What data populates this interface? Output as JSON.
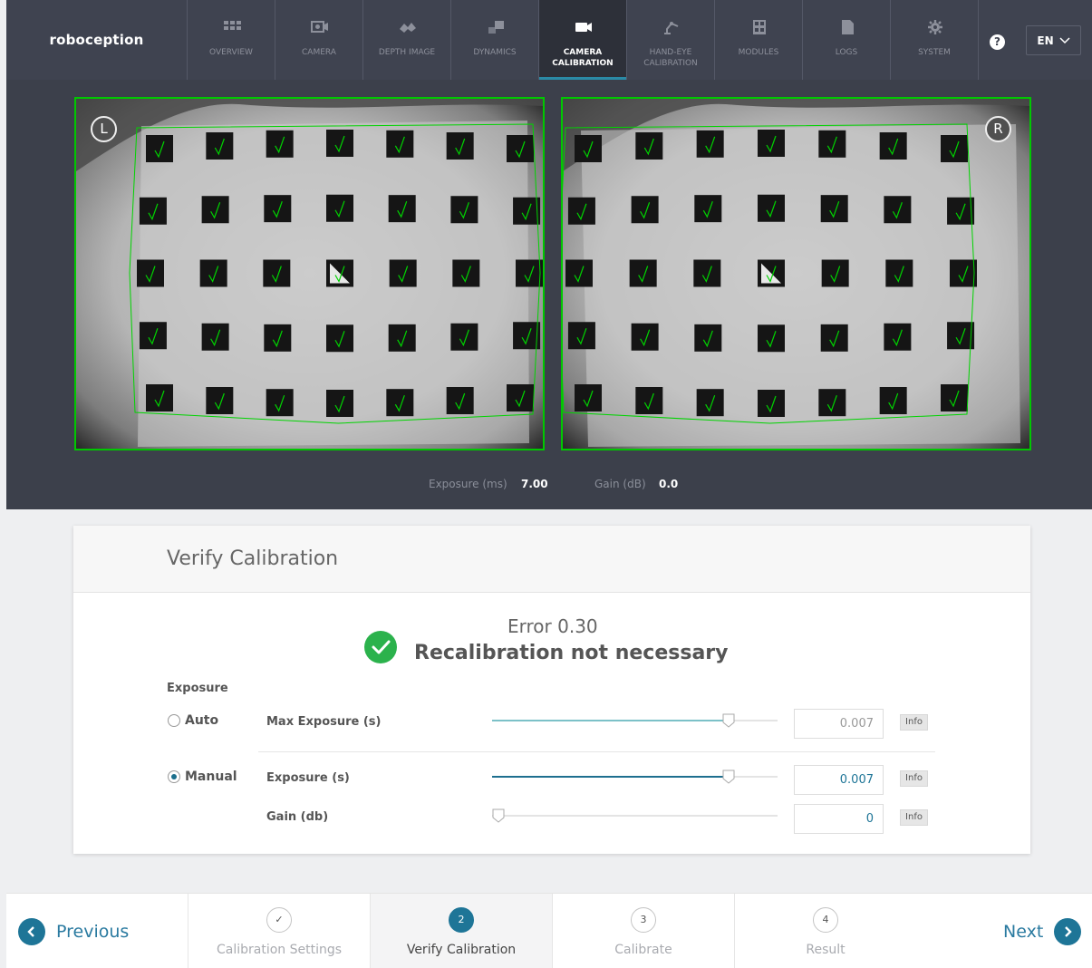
{
  "brand": "roboception",
  "nav": [
    {
      "label": "OVERVIEW",
      "icon": "grid-icon",
      "active": false
    },
    {
      "label": "CAMERA",
      "icon": "camera-icon",
      "active": false
    },
    {
      "label": "DEPTH IMAGE",
      "icon": "depth-image-icon",
      "active": false
    },
    {
      "label": "DYNAMICS",
      "icon": "dynamics-icon",
      "active": false
    },
    {
      "label": "CAMERA\nCALIBRATION",
      "icon": "video-camera-icon",
      "active": true
    },
    {
      "label": "HAND-EYE\nCALIBRATION",
      "icon": "robot-arm-icon",
      "active": false
    },
    {
      "label": "MODULES",
      "icon": "modules-icon",
      "active": false
    },
    {
      "label": "LOGS",
      "icon": "document-icon",
      "active": false
    },
    {
      "label": "SYSTEM",
      "icon": "gear-icon",
      "active": false
    }
  ],
  "help_icon": "?",
  "language": "EN",
  "camera": {
    "left_badge": "L",
    "right_badge": "R",
    "exposure_label": "Exposure (ms)",
    "exposure_value": "7.00",
    "gain_label": "Gain (dB)",
    "gain_value": "0.0"
  },
  "card": {
    "title": "Verify Calibration",
    "error": "Error 0.30",
    "status": "Recalibration not necessary",
    "exposure_heading": "Exposure",
    "auto_label": "Auto",
    "manual_label": "Manual",
    "max_exposure_label": "Max Exposure (s)",
    "max_exposure_value": "0.007",
    "max_exposure_level": 0.83,
    "exposure_label": "Exposure (s)",
    "exposure_value": "0.007",
    "exposure_level": 0.83,
    "gain_label": "Gain (db)",
    "gain_value": "0",
    "gain_level": 0.0,
    "info_label": "Info",
    "mode": "Manual"
  },
  "stepper": {
    "previous": "Previous",
    "next": "Next",
    "steps": [
      {
        "marker": "✓",
        "label": "Calibration Settings",
        "active": false
      },
      {
        "marker": "2",
        "label": "Verify Calibration",
        "active": true
      },
      {
        "marker": "3",
        "label": "Calibrate",
        "active": false
      },
      {
        "marker": "4",
        "label": "Result",
        "active": false
      }
    ]
  },
  "colors": {
    "nav_bg": "#3f4350",
    "accent": "#1e7597",
    "detection_green": "#00c800",
    "success_green": "#2bb24c"
  }
}
